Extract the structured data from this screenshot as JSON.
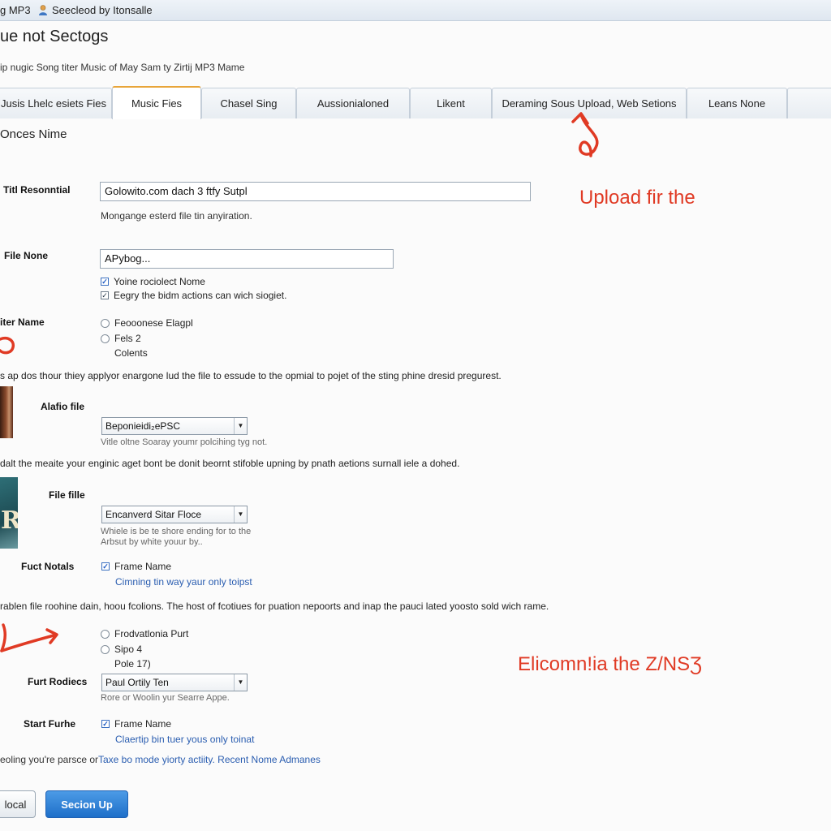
{
  "titlebar": {
    "tab_title": "g MP3",
    "user_label": "Seecleod by Itonsalle"
  },
  "page": {
    "heading": "ue not Sectogs",
    "subheading": "ip nugic Song titer Music of May Sam ty Zirtij MP3 Mame"
  },
  "tabs": [
    {
      "label": "Jusis Lhelc esiets Fies",
      "active": false
    },
    {
      "label": "Music Fies",
      "active": true
    },
    {
      "label": "Chasel Sing",
      "active": false
    },
    {
      "label": "Aussionialoned",
      "active": false
    },
    {
      "label": "Likent",
      "active": false
    },
    {
      "label": "Deraming Sous Upload, Web Setions",
      "active": false
    },
    {
      "label": "Leans None",
      "active": false
    },
    {
      "label": "",
      "active": false
    }
  ],
  "section_title": "Onces Nime",
  "form": {
    "title_resonantial": {
      "label": "Titl Resonntial",
      "value": "Golowito.com dach 3 ftfy Sutpl",
      "hint": "Mongange esterd file tin anyiration."
    },
    "file_none": {
      "label": "File None",
      "value": "APybog...",
      "check1": "Yoine rociolect Nome",
      "check2": "Eegry the bidm actions can wich siogiet."
    },
    "filter_name": {
      "label": "iter Name",
      "options": [
        "Feooonese Elagpl",
        "Fels 2",
        "Colents"
      ]
    },
    "desc1": "s ap dos thour thiey applyor enargone lud the file to essude to the opmial to pojet of the sting phine dresid pregurest.",
    "alafio_file": {
      "label": "Alafio file",
      "select": "Beponieidi₂ePSC",
      "hint": "Vitle oltne Soaray youmr polcihing tyg not."
    },
    "desc2": "dalt the meaite your enginic aget bont be donit beornt stifoble upning by pnath aetions surnall iele a dohed.",
    "file_fille": {
      "label": "File fille",
      "select": "Encanverd Sitar Floce",
      "hint1": "Whiele is be te shore ending for to the",
      "hint2": "Arbsut by white youur by.."
    },
    "fuct_notals": {
      "label": "Fuct Notals",
      "check": "Frame Name",
      "link": "Cimning tin way yaur only toipst"
    },
    "desc3": "rablen file roohine dain, hoou fcolions. The host of fcotiues for puation nepoorts and inap the pauci lated yoosto sold wich rame.",
    "radios2": [
      "Frodvatlonia Purt",
      "Sipo 4",
      "Pole 17)"
    ],
    "furt_rodiecs": {
      "label": "Furt Rodiecs",
      "select": "Paul Ortily Ten",
      "hint": "Rore or Woolin yur Searre Appe."
    },
    "start_furhe": {
      "label": "Start Furhe",
      "check": "Frame Name",
      "link": "Claertip bin tuer yous only toinat"
    },
    "footer_prefix": "eoling you're parsce or",
    "footer_link": "Taxe bo mode yiorty actiity. Recent Nome Admanes"
  },
  "buttons": {
    "secondary": "local",
    "primary": "Secion Up"
  },
  "annotations": {
    "upload": "Upload fir the",
    "elicomn": "Elicomn!ia the Z/NSƷ",
    "color": "#e03a24"
  },
  "icons": {
    "user": "user-icon",
    "dropdown": "chevron-down-icon"
  },
  "colors": {
    "active_tab_accent": "#e8a53a",
    "primary_button": "#1e6fc9",
    "link": "#2a5db0"
  }
}
